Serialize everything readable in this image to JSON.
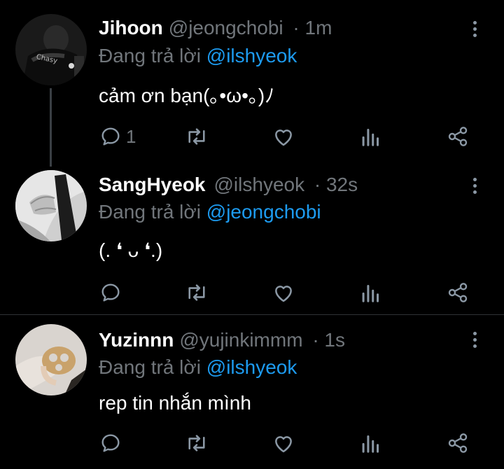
{
  "tweets": [
    {
      "name": "Jihoon",
      "handle": "@jeongchobi",
      "time": "· 1m",
      "reply_prefix": "Đang trả lời",
      "reply_to": "@ilshyeok",
      "text": "cảm ơn bạn(｡•ω•｡)ﾉ",
      "reply_count": "1"
    },
    {
      "name": "SangHyeok",
      "handle": "@ilshyeok",
      "time": "· 32s",
      "reply_prefix": "Đang trả lời",
      "reply_to": "@jeongchobi",
      "text": "(. ❛ ᴗ ❛.)",
      "reply_count": ""
    },
    {
      "name": "Yuzinnn",
      "handle": "@yujinkimmm",
      "time": "· 1s",
      "reply_prefix": "Đang trả lời",
      "reply_to": "@ilshyeok",
      "text": "rep tin nhắn mình",
      "reply_count": ""
    }
  ],
  "icons": [
    "reply-icon",
    "retweet-icon",
    "like-icon",
    "views-icon",
    "share-icon",
    "more-icon"
  ],
  "colors": {
    "background": "#000000",
    "mention": "#1d9bf0",
    "muted": "#71767b",
    "icon": "#8b98a5"
  }
}
